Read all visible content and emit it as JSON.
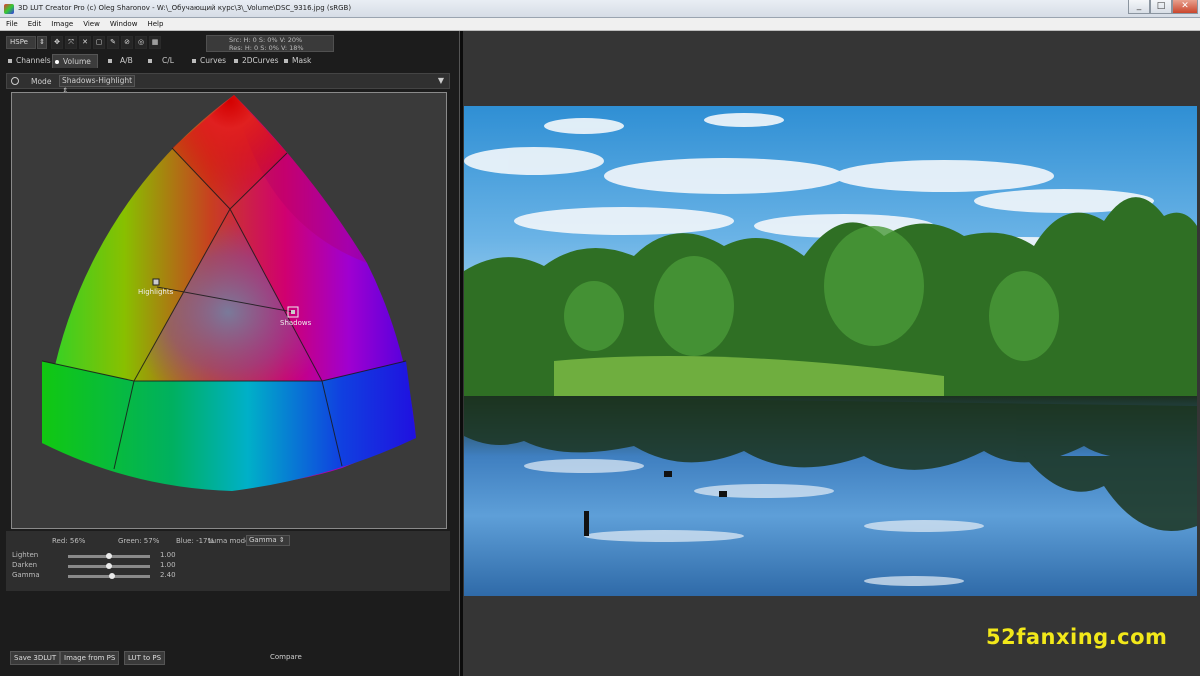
{
  "window": {
    "title": "3D LUT Creator Pro (c) Oleg Sharonov - W:\\_Обучающий курс\\3\\_Volume\\DSC_9316.jpg (sRGB)",
    "controls": [
      "_",
      "□",
      "✕"
    ]
  },
  "menu": [
    "File",
    "Edit",
    "Image",
    "View",
    "Window",
    "Help"
  ],
  "toolbar": {
    "colorspace": "HSPe",
    "readout": {
      "src": "Src: H:   0   S:   0%   V:  20%",
      "res": "Res: H:   0   S:   0%   V:  18%"
    }
  },
  "tabs": [
    {
      "label": "Channels",
      "active": false
    },
    {
      "label": "Volume",
      "active": true
    },
    {
      "label": "A/B",
      "active": false
    },
    {
      "label": "C/L",
      "active": false
    },
    {
      "label": "Curves",
      "active": false
    },
    {
      "label": "2DCurves",
      "active": false
    },
    {
      "label": "Mask",
      "active": false
    }
  ],
  "mode": {
    "label": "Mode",
    "value": "Shadows-Highlight"
  },
  "graph": {
    "highlight_label": "Highlights",
    "shadow_label": "Shadows"
  },
  "controls": {
    "red": "Red:   56%",
    "green": "Green:  57%",
    "blue": "Blue:  -17%",
    "luma_label": "Luma mode",
    "luma_value": "Gamma",
    "sliders": [
      {
        "label": "Lighten",
        "value": "1.00",
        "position": 0.5
      },
      {
        "label": "Darken",
        "value": "1.00",
        "position": 0.5
      },
      {
        "label": "Gamma",
        "value": "2.40",
        "position": 0.53
      }
    ]
  },
  "bottom": {
    "save": "Save 3DLUT",
    "image_from_ps": "Image from PS",
    "lut_to_ps": "LUT to PS",
    "compare": "Compare"
  },
  "watermark": "52fanxing.com",
  "colors": {
    "panel": "#1c1c1c",
    "viewer": "#353535",
    "watermark": "#f2e81a"
  }
}
